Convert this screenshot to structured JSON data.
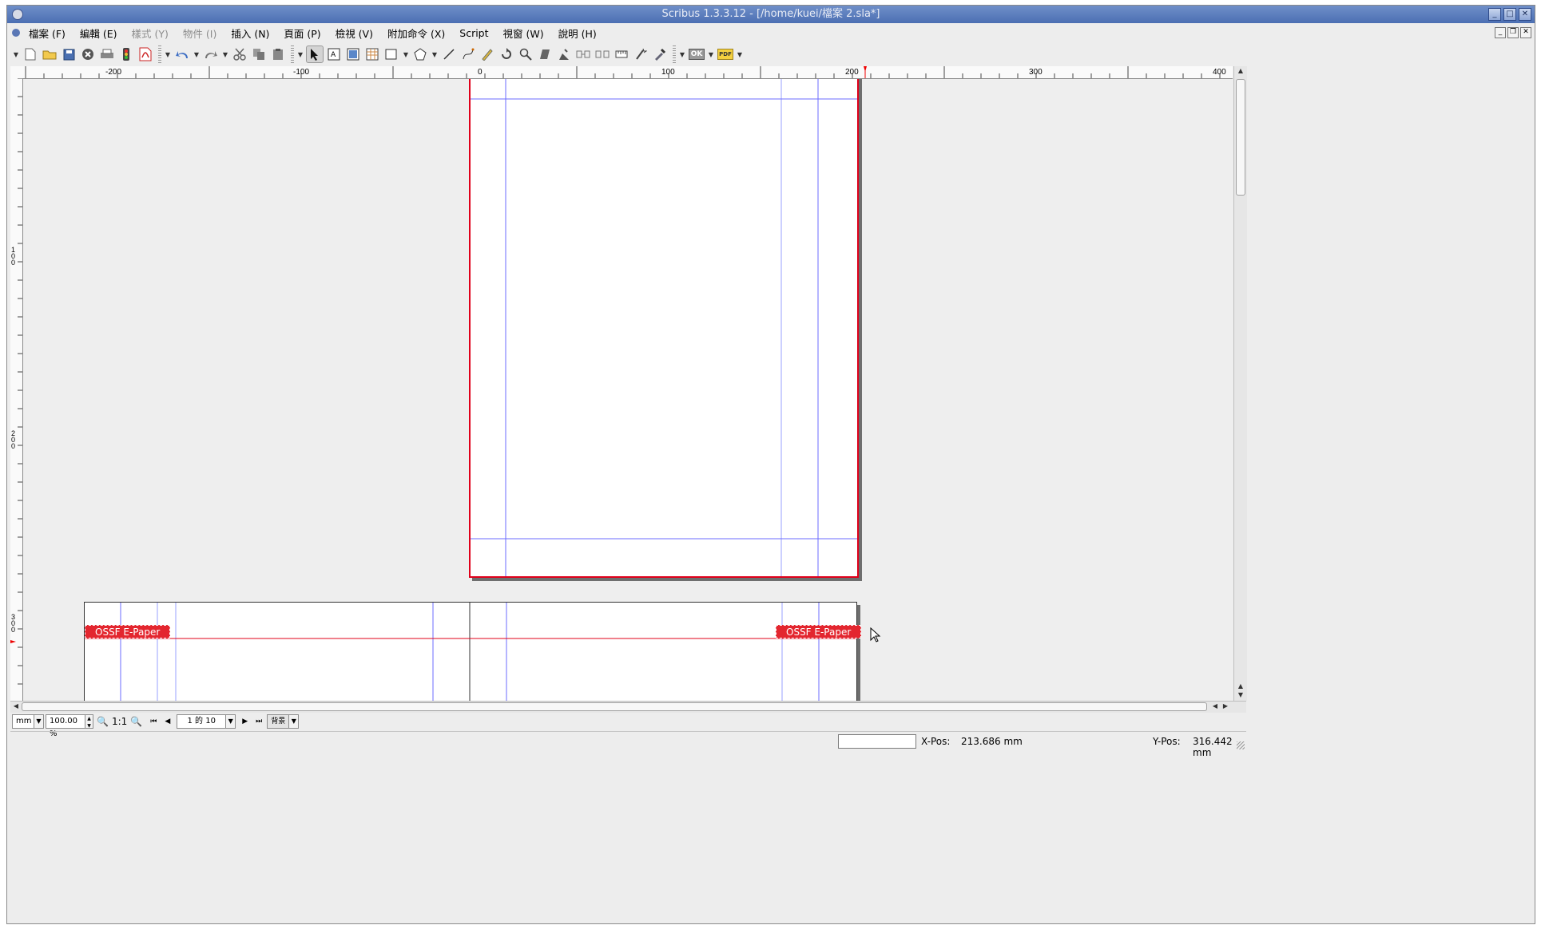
{
  "window": {
    "title": "Scribus 1.3.3.12 - [/home/kuei/檔案 2.sla*]",
    "buttons": {
      "minimize": "_",
      "maximize": "□",
      "close": "✕"
    }
  },
  "menu": [
    {
      "label": "檔案 (F)",
      "enabled": true
    },
    {
      "label": "編輯 (E)",
      "enabled": true
    },
    {
      "label": "樣式 (Y)",
      "enabled": false
    },
    {
      "label": "物件 (I)",
      "enabled": false
    },
    {
      "label": "插入 (N)",
      "enabled": true
    },
    {
      "label": "頁面 (P)",
      "enabled": true
    },
    {
      "label": "檢視 (V)",
      "enabled": true
    },
    {
      "label": "附加命令 (X)",
      "enabled": true
    },
    {
      "label": "Script",
      "enabled": true
    },
    {
      "label": "視窗 (W)",
      "enabled": true
    },
    {
      "label": "說明 (H)",
      "enabled": true
    }
  ],
  "toolbar": {
    "icons": [
      "new-document-icon",
      "open-icon",
      "save-icon",
      "close-document-icon",
      "print-icon",
      "preflight-icon",
      "export-pdf-icon",
      "undo-icon",
      "redo-icon",
      "cut-icon",
      "copy-icon",
      "paste-icon",
      "select-icon",
      "text-frame-icon",
      "image-frame-icon",
      "table-icon",
      "shape-icon",
      "polygon-icon",
      "line-icon",
      "bezier-icon",
      "freehand-icon",
      "rotate-icon",
      "zoom-icon",
      "edit-contents-icon",
      "edit-text-icon",
      "link-frames-icon",
      "unlink-frames-icon",
      "measure-icon",
      "copy-properties-icon",
      "eyedropper-icon",
      "pdf-pushbutton-icon",
      "pdf-field-icon"
    ],
    "ok_label": "OK",
    "pdf_label": "PDF"
  },
  "rulers": {
    "horizontal_labels": [
      "-200",
      "-100",
      "0",
      "100",
      "200",
      "300",
      "400"
    ],
    "vertical_labels": [
      "100",
      "200",
      "300"
    ]
  },
  "canvas": {
    "frame_text_left": "OSSF E-Paper",
    "frame_text_right": "OSSF E-Paper"
  },
  "bottom": {
    "unit": "mm",
    "zoom": "100.00 %",
    "zoom_1to1": "1:1",
    "page_indicator": "1 的 10",
    "layer": "背景"
  },
  "status": {
    "input_value": "",
    "xpos_label": "X-Pos:",
    "xpos_value": "213.686 mm",
    "ypos_label": "Y-Pos:",
    "ypos_value": "316.442 mm"
  },
  "colors": {
    "accent_red": "#e3262f",
    "guide_blue": "#6b6bff",
    "title_blue": "#4c6fb3"
  }
}
